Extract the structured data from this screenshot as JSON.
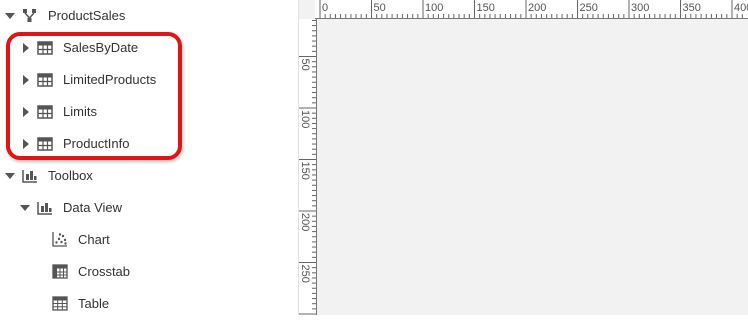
{
  "tree": {
    "root": {
      "label": "ProductSales",
      "icon": "data-source-icon"
    },
    "items": [
      {
        "label": "SalesByDate",
        "icon": "table-grid-icon"
      },
      {
        "label": "LimitedProducts",
        "icon": "table-grid-icon"
      },
      {
        "label": "Limits",
        "icon": "table-grid-icon"
      },
      {
        "label": "ProductInfo",
        "icon": "table-grid-icon"
      }
    ],
    "toolbox": {
      "label": "Toolbox",
      "icon": "toolbox-icon"
    },
    "data_view": {
      "label": "Data View",
      "icon": "data-view-icon"
    },
    "tools": [
      {
        "label": "Chart",
        "icon": "scatter-chart-icon"
      },
      {
        "label": "Crosstab",
        "icon": "crosstab-icon"
      },
      {
        "label": "Table",
        "icon": "table-tool-icon"
      }
    ]
  },
  "highlight_color": "#e01414",
  "rulers": {
    "horizontal_labels": [
      "0",
      "50",
      "100",
      "150",
      "200",
      "250",
      "300",
      "350",
      "400"
    ],
    "vertical_labels": [
      "50",
      "100",
      "150",
      "200",
      "250"
    ]
  }
}
